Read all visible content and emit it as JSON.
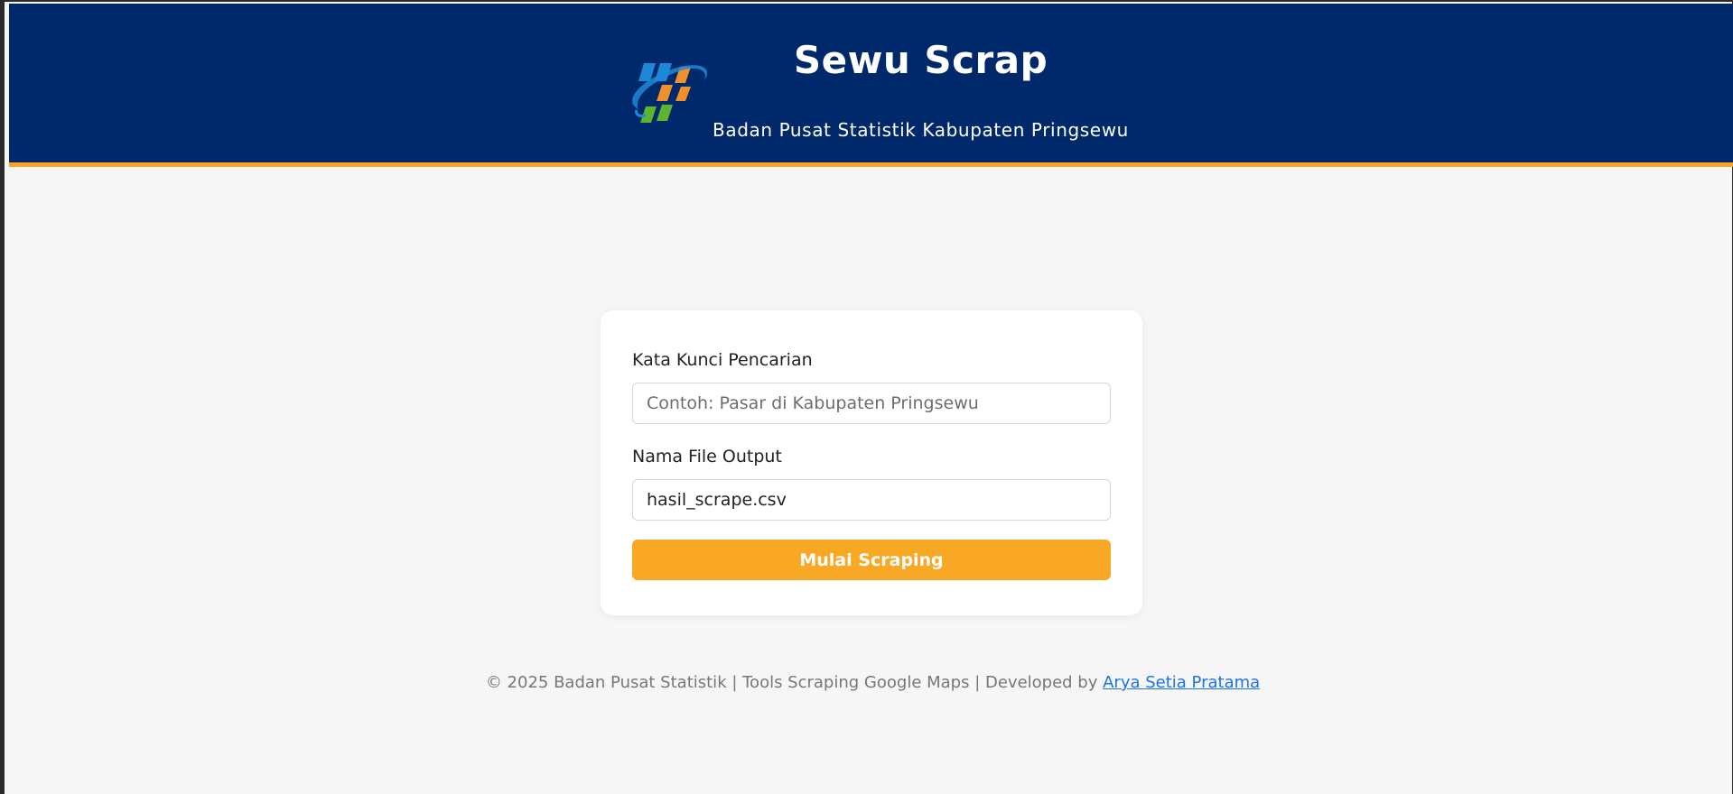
{
  "header": {
    "title": "Sewu Scrap",
    "subtitle": "Badan Pusat Statistik Kabupaten Pringsewu",
    "logo_icon": "bps-logo-icon"
  },
  "form": {
    "keyword_label": "Kata Kunci Pencarian",
    "keyword_placeholder": "Contoh: Pasar di Kabupaten Pringsewu",
    "keyword_value": "",
    "filename_label": "Nama File Output",
    "filename_value": "hasil_scrape.csv",
    "submit_label": "Mulai Scraping"
  },
  "footer": {
    "text": "© 2025 Badan Pusat Statistik | Tools Scraping Google Maps | Developed by ",
    "author_link": "Arya Setia Pratama"
  },
  "colors": {
    "header_bg": "#00296b",
    "accent": "#f5a623",
    "button": "#f9a825",
    "link": "#1a73e8"
  }
}
